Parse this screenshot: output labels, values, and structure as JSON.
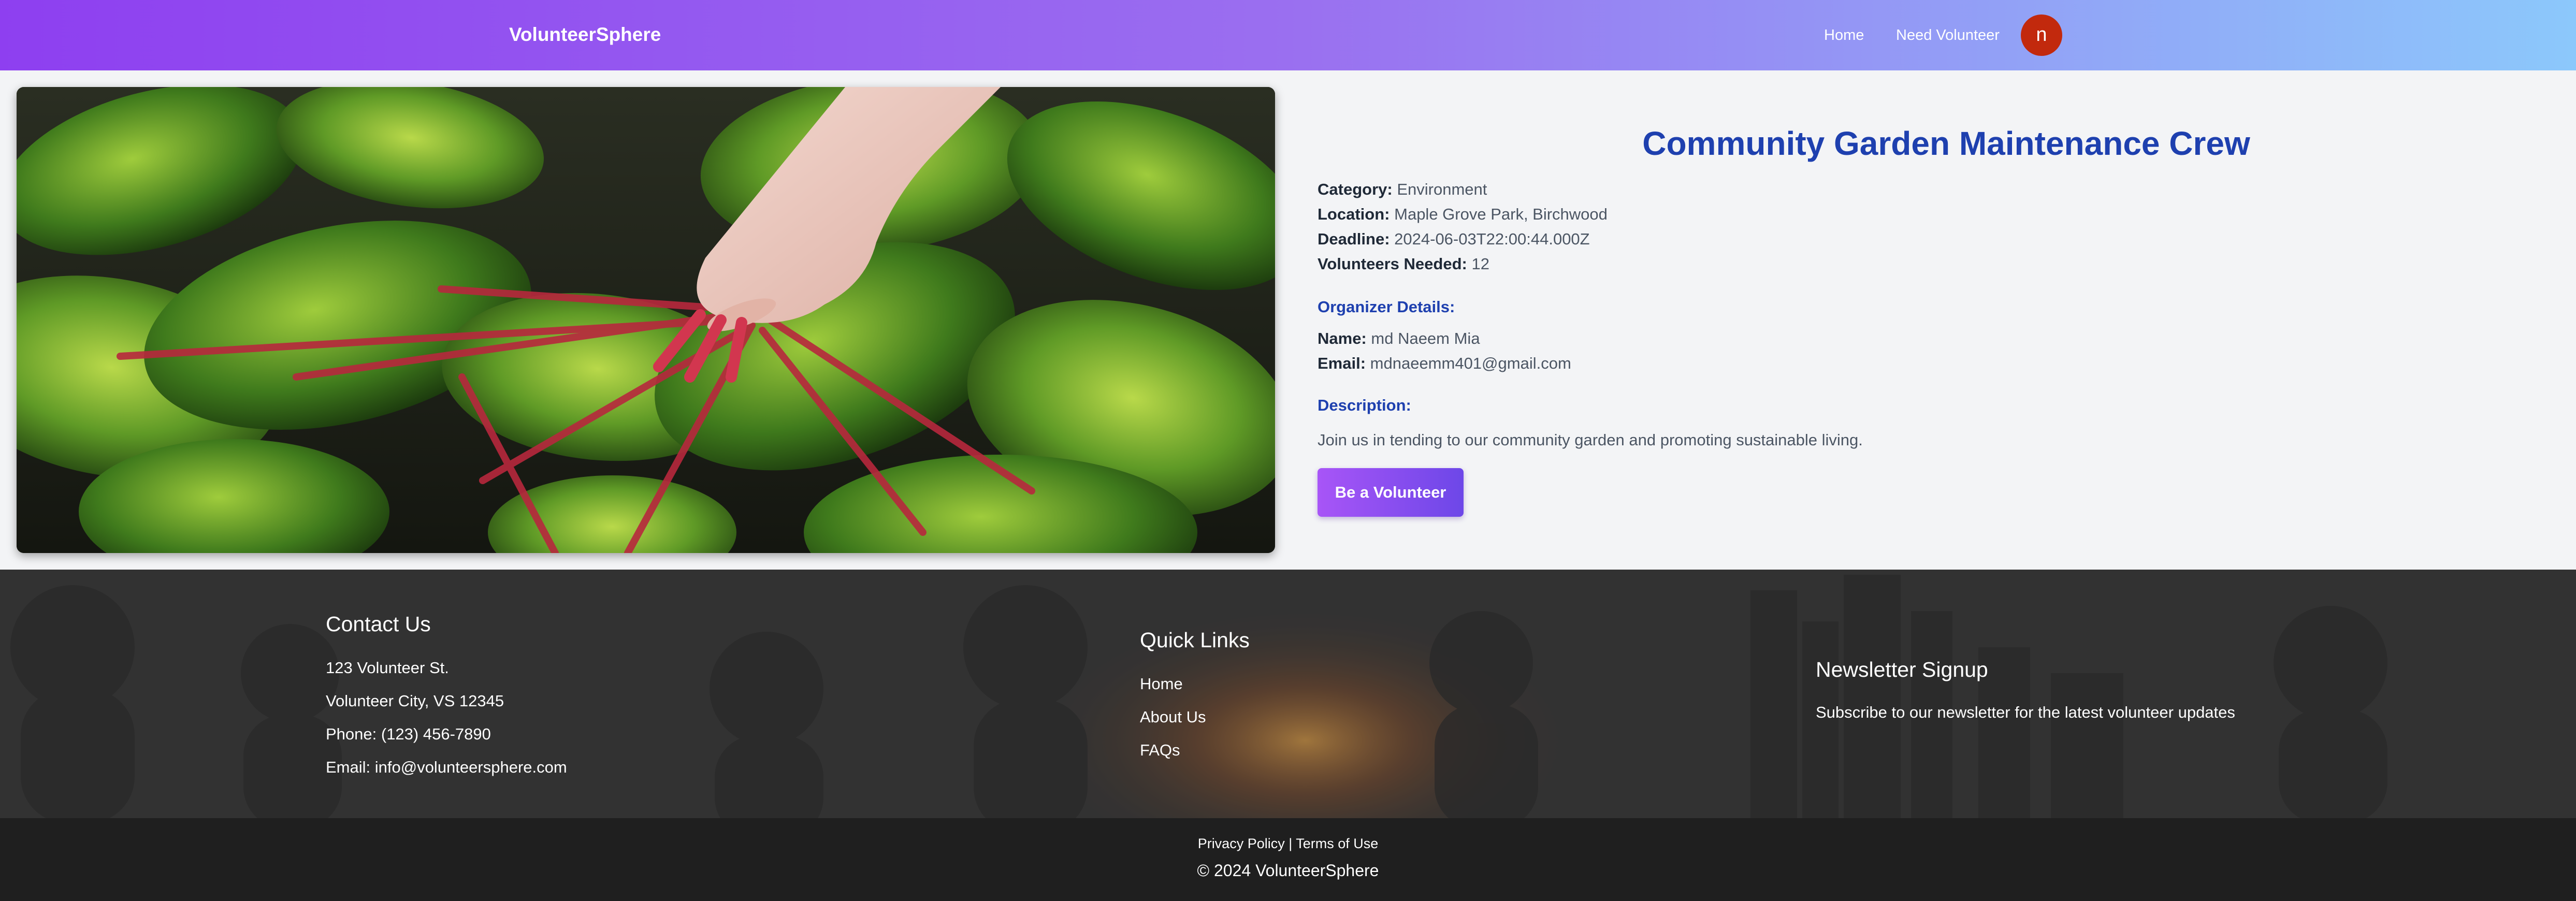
{
  "navbar": {
    "brand": "VolunteerSphere",
    "links": [
      "Home",
      "Need Volunteer"
    ],
    "avatar_initial": "n",
    "avatar_color": "#c2290d"
  },
  "post": {
    "image_alt": "hand pulling rhubarb stalks among leafy greens",
    "title": "Community Garden Maintenance Crew",
    "fields": [
      {
        "label": "Category:",
        "value": "Environment"
      },
      {
        "label": "Location:",
        "value": "Maple Grove Park, Birchwood"
      },
      {
        "label": "Deadline:",
        "value": "2024-06-03T22:00:44.000Z"
      },
      {
        "label": "Volunteers Needed:",
        "value": "12"
      }
    ],
    "organizer_heading": "Organizer Details:",
    "organizer": [
      {
        "label": "Name:",
        "value": "md Naeem Mia"
      },
      {
        "label": "Email:",
        "value": "mdnaeemm401@gmail.com"
      }
    ],
    "description_heading": "Description:",
    "description": "Join us in tending to our community garden and promoting sustainable living.",
    "cta_label": "Be a Volunteer"
  },
  "footer": {
    "contact": {
      "heading": "Contact Us",
      "lines": [
        "123 Volunteer St.",
        "Volunteer City, VS 12345",
        "Phone: (123) 456-7890",
        "Email: info@volunteersphere.com"
      ]
    },
    "quick_links": {
      "heading": "Quick Links",
      "links": [
        "Home",
        "About Us",
        "FAQs"
      ]
    },
    "newsletter": {
      "heading": "Newsletter Signup",
      "text": "Subscribe to our newsletter for the latest volunteer updates"
    },
    "policy": {
      "privacy": "Privacy Policy",
      "separator": " | ",
      "terms": "Terms of Use"
    },
    "copyright": "© 2024 VolunteerSphere"
  },
  "colors": {
    "accent_title": "#1e40af",
    "nav_gradient_start": "#8e3ff0",
    "nav_gradient_end": "#8cc8fb",
    "button_gradient_start": "#a855f7",
    "button_gradient_end": "#6d47e8"
  }
}
